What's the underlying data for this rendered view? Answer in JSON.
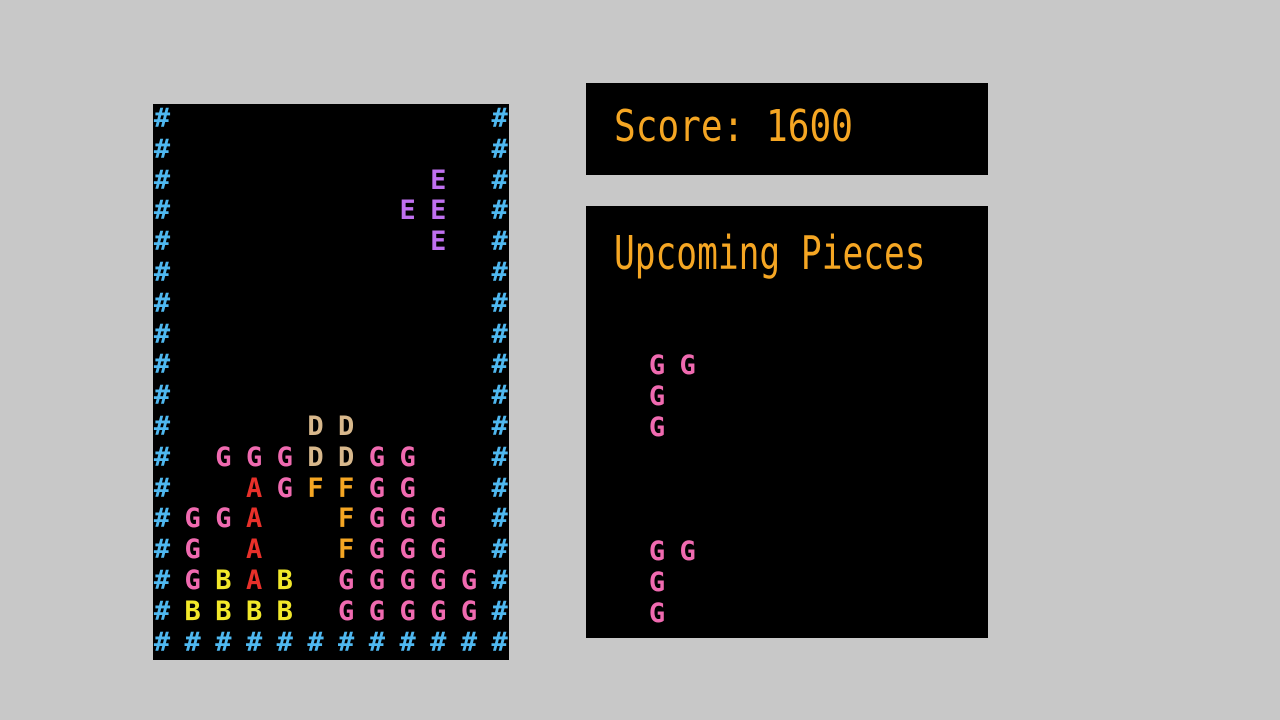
{
  "score": {
    "text": "Score: 1600"
  },
  "upcoming": {
    "title": "Upcoming Pieces",
    "pieces": [
      {
        "cells": [
          [
            0,
            0,
            "G"
          ],
          [
            0,
            1,
            "G"
          ],
          [
            1,
            0,
            "G"
          ],
          [
            2,
            0,
            "G"
          ]
        ]
      },
      {
        "cells": [
          [
            0,
            0,
            "G"
          ],
          [
            0,
            1,
            "G"
          ],
          [
            1,
            0,
            "G"
          ],
          [
            2,
            0,
            "G"
          ]
        ]
      }
    ]
  },
  "colors": {
    "wall": "#4fb8f0",
    "A": "#e8302a",
    "B": "#f2e82a",
    "D": "#d8b88c",
    "E": "#c070f0",
    "F": "#f5a623",
    "G": "#f06ab0",
    "text": "#f5a623"
  },
  "board": {
    "cols": 12,
    "rows": 18,
    "rows_text": [
      "#          #",
      "#          #",
      "#        E #",
      "#       EE #",
      "#        E #",
      "#          #",
      "#          #",
      "#          #",
      "#          #",
      "#          #",
      "#    DD    #",
      "# GGGDDGG  #",
      "#  AGFFGG  #",
      "#GGA  FGGG #",
      "#G A  FGGG #",
      "#GBAB GGGGG#",
      "#BBBB GGGGG#",
      "############"
    ]
  }
}
